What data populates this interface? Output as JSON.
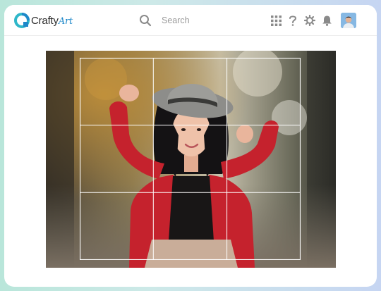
{
  "app": {
    "brand_prefix": "Crafty",
    "brand_suffix": "Art"
  },
  "search": {
    "placeholder": "Search"
  },
  "header": {
    "icons": [
      "apps-grid-icon",
      "help-icon",
      "settings-icon",
      "notification-bell-icon"
    ]
  },
  "editor": {
    "crop_grid": {
      "rows": 3,
      "columns": 3
    }
  },
  "colors": {
    "brand_blue": "#1e88c9",
    "brand_teal": "#2fb7c9",
    "icon_gray": "#8a8a8a",
    "jacket_red": "#c5222d"
  }
}
